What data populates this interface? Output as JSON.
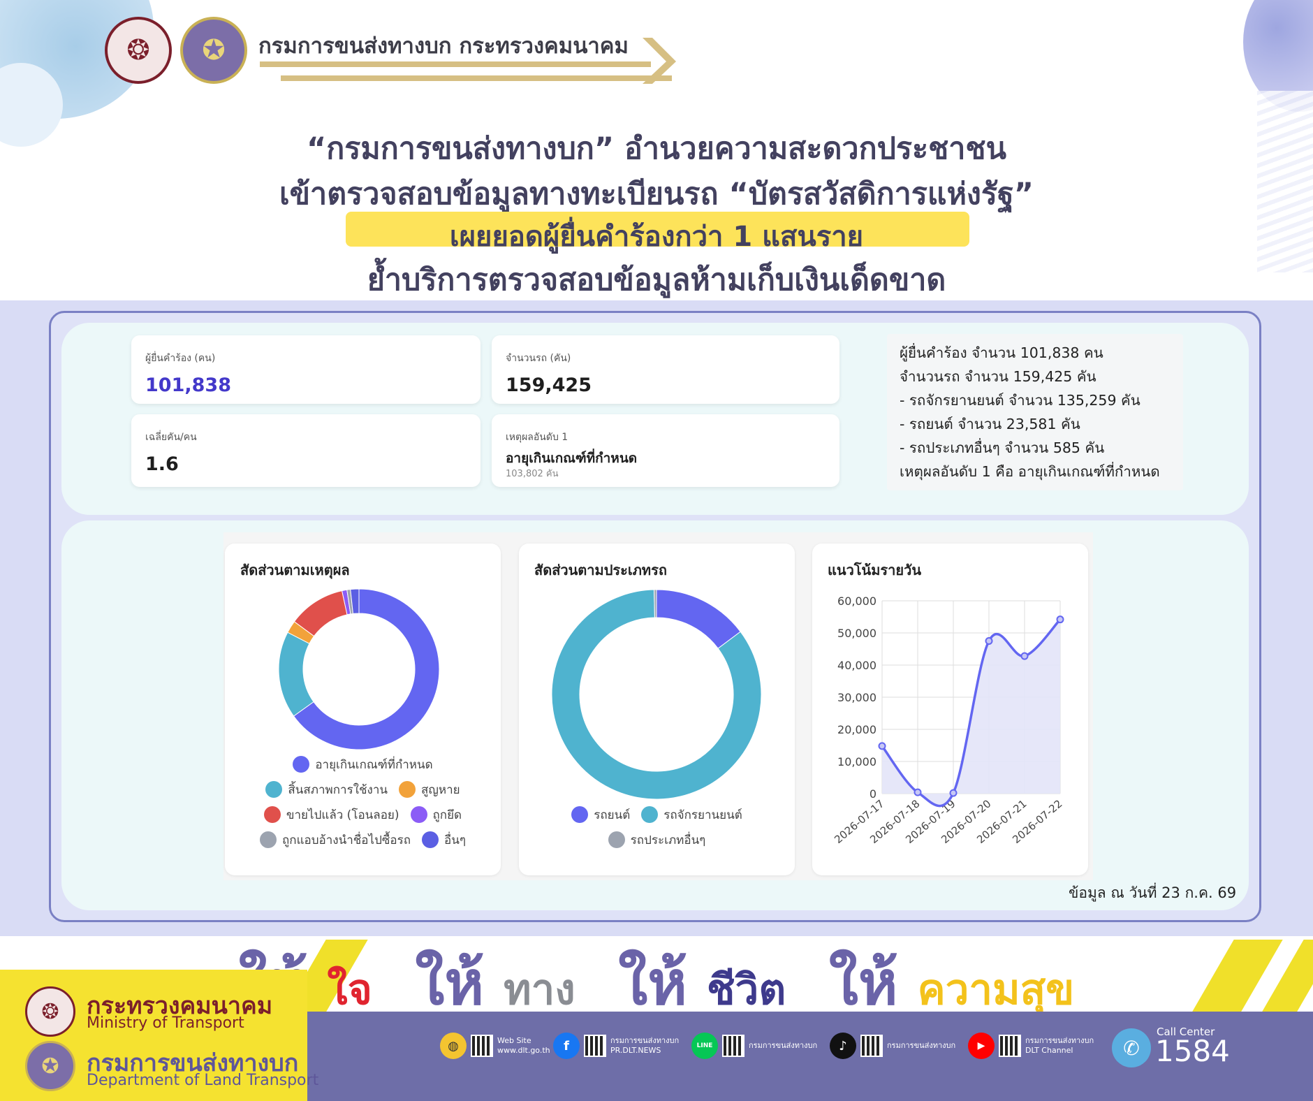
{
  "header": {
    "org_name": "กรมการขนส่งทางบก กระทรวงคมนาคม",
    "headline_1": "“กรมการขนส่งทางบก” อำนวยความสะดวกประชาชน",
    "headline_2": "เข้าตรวจสอบข้อมูลทางทะเบียนรถ “บัตรสวัสดิการแห่งรัฐ”",
    "headline_3": "เผยยอดผู้ยื่นคำร้องกว่า 1 แสนราย",
    "headline_4": "ย้ำบริการตรวจสอบข้อมูลห้ามเก็บเงินเด็ดขาด",
    "highlight_color": "#fde35a"
  },
  "kpis": {
    "applicants": {
      "label": "ผู้ยื่นคำร้อง (คน)",
      "value": "101,838"
    },
    "vehicles": {
      "label": "จำนวนรถ (คัน)",
      "value": "159,425"
    },
    "avg": {
      "label": "เฉลี่ยคัน/คน",
      "value": "1.6"
    },
    "top_reason": {
      "label": "เหตุผลอันดับ 1",
      "value": "อายุเกินเกณฑ์ที่กำหนด",
      "sub": "103,802 คัน"
    }
  },
  "summary": {
    "lines": [
      "ผู้ยื่นคำร้อง จำนวน 101,838 คน",
      "จำนวนรถ จำนวน 159,425 คัน",
      "- รถจักรยานยนต์ จำนวน 135,259 คัน",
      "- รถยนต์ จำนวน 23,581 คัน",
      "- รถประเภทอื่นๆ จำนวน 585 คัน",
      "เหตุผลอันดับ 1 คือ อายุเกินเกณฑ์ที่กำหนด"
    ]
  },
  "chart_data": [
    {
      "type": "pie",
      "title": "สัดส่วนตามเหตุผล",
      "donut": true,
      "categories": [
        "อายุเกินเกณฑ์ที่กำหนด",
        "สิ้นสภาพการใช้งาน",
        "สูญหาย",
        "ขายไปแล้ว (โอนลอย)",
        "ถูกยึด",
        "ถูกแอบอ้างนำชื่อไปซื้อรถ",
        "อื่นๆ"
      ],
      "values": [
        65.1,
        17.5,
        2.5,
        11.5,
        1.0,
        0.7,
        1.7
      ],
      "colors": [
        "#6366f1",
        "#4fb3cf",
        "#f2a23a",
        "#e0504b",
        "#8b5cf6",
        "#9ca3af",
        "#5b5fe3"
      ],
      "legend_position": "bottom"
    },
    {
      "type": "pie",
      "title": "สัดส่วนตามประเภทรถ",
      "donut": true,
      "categories": [
        "รถยนต์",
        "รถจักรยานยนต์",
        "รถประเภทอื่นๆ"
      ],
      "values": [
        23581,
        135259,
        585
      ],
      "colors": [
        "#6366f1",
        "#4fb3cf",
        "#9ca3af"
      ],
      "legend_position": "bottom"
    },
    {
      "type": "area",
      "title": "แนวโน้มรายวัน",
      "x": [
        "2026-07-17",
        "2026-07-18",
        "2026-07-19",
        "2026-07-20",
        "2026-07-21",
        "2026-07-22"
      ],
      "values": [
        14800,
        400,
        200,
        47500,
        42800,
        54200
      ],
      "ylim": [
        0,
        60000
      ],
      "yticks": [
        "0",
        "10,000",
        "20,000",
        "30,000",
        "40,000",
        "50,000",
        "60,000"
      ],
      "grid": true,
      "line_color": "#6366f1",
      "fill_color": "#e3e4f8"
    }
  ],
  "data_date": "ข้อมูล ณ วันที่ 23 ก.ค. 69",
  "slogan": {
    "give": "ให้",
    "w1": "ใจ",
    "w2": "ทาง",
    "w3": "ชีวิต",
    "w4": "ความสุข"
  },
  "footer": {
    "mot_th": "กระทรวงคมนาคม",
    "mot_en": "Ministry of Transport",
    "dlt_th": "กรมการขนส่งทางบก",
    "dlt_en": "Department of Land Transport",
    "channels": [
      {
        "icon": "globe-icon",
        "line1": "Web Site",
        "line2": "www.dlt.go.th"
      },
      {
        "icon": "facebook-icon",
        "line1": "กรมการขนส่งทางบก",
        "line2": "PR.DLT.NEWS"
      },
      {
        "icon": "line-icon",
        "line1": "กรมการขนส่งทางบก",
        "line2": ""
      },
      {
        "icon": "tiktok-icon",
        "line1": "กรมการขนส่งทางบก",
        "line2": ""
      },
      {
        "icon": "youtube-icon",
        "line1": "กรมการขนส่งทางบก",
        "line2": "DLT Channel"
      }
    ],
    "call_center_label": "Call Center",
    "call_center_number": "1584"
  }
}
